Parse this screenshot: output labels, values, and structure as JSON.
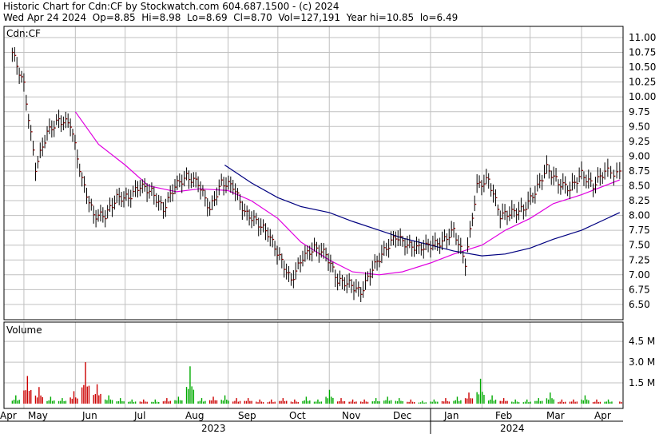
{
  "header": {
    "line1": "Historic Chart for Cdn:CF by Stockwatch.com 604.687.1500 - (c) 2024",
    "line2": "Wed Apr 24 2024  Op=8.85  Hi=8.98  Lo=8.69  Cl=8.70  Vol=127,191  Year hi=10.85  lo=6.49"
  },
  "colors": {
    "bar": "#8b0000",
    "ma_short": "#e000e0",
    "ma_long": "#000080",
    "vol_up": "#00aa00",
    "vol_down": "#cc0000",
    "grid": "#c0c0c0"
  },
  "chart_data": {
    "type": "line",
    "title": "Historic Chart for Cdn:CF",
    "symbol_label": "Cdn:CF",
    "price_axis": {
      "ticks": [
        "11.00",
        "10.75",
        "10.50",
        "10.25",
        "10.00",
        "9.75",
        "9.50",
        "9.25",
        "9.00",
        "8.75",
        "8.50",
        "8.25",
        "8.00",
        "7.75",
        "7.50",
        "7.25",
        "7.00",
        "6.75",
        "6.50"
      ],
      "ylim": [
        6.25,
        11.1
      ]
    },
    "volume_axis": {
      "label": "Volume",
      "ticks": [
        "4.5 M",
        "3.0 M",
        "1.5 M"
      ]
    },
    "months": [
      "Apr",
      "May",
      "Jun",
      "Jul",
      "Aug",
      "Sep",
      "Oct",
      "Nov",
      "Dec",
      "Jan",
      "Feb",
      "Mar",
      "Apr"
    ],
    "years": [
      "2023",
      "2024"
    ],
    "price_close_weekly": [
      {
        "t": "2023-04-24",
        "v": 10.75
      },
      {
        "t": "2023-05-01",
        "v": 10.2
      },
      {
        "t": "2023-05-08",
        "v": 8.8
      },
      {
        "t": "2023-05-15",
        "v": 9.4
      },
      {
        "t": "2023-05-22",
        "v": 9.6
      },
      {
        "t": "2023-05-29",
        "v": 9.55
      },
      {
        "t": "2023-06-05",
        "v": 8.6
      },
      {
        "t": "2023-06-12",
        "v": 8.0
      },
      {
        "t": "2023-06-19",
        "v": 8.0
      },
      {
        "t": "2023-06-26",
        "v": 8.3
      },
      {
        "t": "2023-07-03",
        "v": 8.3
      },
      {
        "t": "2023-07-10",
        "v": 8.5
      },
      {
        "t": "2023-07-17",
        "v": 8.4
      },
      {
        "t": "2023-07-24",
        "v": 8.1
      },
      {
        "t": "2023-07-31",
        "v": 8.5
      },
      {
        "t": "2023-08-07",
        "v": 8.65
      },
      {
        "t": "2023-08-14",
        "v": 8.55
      },
      {
        "t": "2023-08-21",
        "v": 8.1
      },
      {
        "t": "2023-08-28",
        "v": 8.55
      },
      {
        "t": "2023-09-04",
        "v": 8.5
      },
      {
        "t": "2023-09-11",
        "v": 8.05
      },
      {
        "t": "2023-09-18",
        "v": 7.9
      },
      {
        "t": "2023-09-25",
        "v": 7.7
      },
      {
        "t": "2023-10-02",
        "v": 7.3
      },
      {
        "t": "2023-10-09",
        "v": 6.9
      },
      {
        "t": "2023-10-16",
        "v": 7.3
      },
      {
        "t": "2023-10-23",
        "v": 7.45
      },
      {
        "t": "2023-10-30",
        "v": 7.35
      },
      {
        "t": "2023-11-06",
        "v": 6.9
      },
      {
        "t": "2023-11-13",
        "v": 6.85
      },
      {
        "t": "2023-11-20",
        "v": 6.7
      },
      {
        "t": "2023-11-27",
        "v": 7.1
      },
      {
        "t": "2023-12-04",
        "v": 7.4
      },
      {
        "t": "2023-12-11",
        "v": 7.65
      },
      {
        "t": "2023-12-18",
        "v": 7.5
      },
      {
        "t": "2023-12-25",
        "v": 7.45
      },
      {
        "t": "2024-01-01",
        "v": 7.5
      },
      {
        "t": "2024-01-08",
        "v": 7.55
      },
      {
        "t": "2024-01-15",
        "v": 7.75
      },
      {
        "t": "2024-01-22",
        "v": 7.2
      },
      {
        "t": "2024-01-29",
        "v": 8.5
      },
      {
        "t": "2024-02-05",
        "v": 8.6
      },
      {
        "t": "2024-02-12",
        "v": 8.0
      },
      {
        "t": "2024-02-19",
        "v": 8.05
      },
      {
        "t": "2024-02-26",
        "v": 8.1
      },
      {
        "t": "2024-03-04",
        "v": 8.4
      },
      {
        "t": "2024-03-11",
        "v": 8.8
      },
      {
        "t": "2024-03-18",
        "v": 8.55
      },
      {
        "t": "2024-03-25",
        "v": 8.45
      },
      {
        "t": "2024-04-01",
        "v": 8.7
      },
      {
        "t": "2024-04-08",
        "v": 8.5
      },
      {
        "t": "2024-04-15",
        "v": 8.75
      },
      {
        "t": "2024-04-24",
        "v": 8.7
      }
    ],
    "ma_short_weekly": [
      {
        "t": "2023-06-01",
        "v": 9.75
      },
      {
        "t": "2023-06-15",
        "v": 9.2
      },
      {
        "t": "2023-07-01",
        "v": 8.85
      },
      {
        "t": "2023-07-15",
        "v": 8.5
      },
      {
        "t": "2023-08-01",
        "v": 8.4
      },
      {
        "t": "2023-08-15",
        "v": 8.45
      },
      {
        "t": "2023-09-01",
        "v": 8.42
      },
      {
        "t": "2023-09-15",
        "v": 8.25
      },
      {
        "t": "2023-10-01",
        "v": 7.95
      },
      {
        "t": "2023-10-15",
        "v": 7.55
      },
      {
        "t": "2023-11-01",
        "v": 7.25
      },
      {
        "t": "2023-11-15",
        "v": 7.05
      },
      {
        "t": "2023-12-01",
        "v": 7.0
      },
      {
        "t": "2023-12-15",
        "v": 7.05
      },
      {
        "t": "2024-01-01",
        "v": 7.2
      },
      {
        "t": "2024-01-15",
        "v": 7.35
      },
      {
        "t": "2024-02-01",
        "v": 7.5
      },
      {
        "t": "2024-02-15",
        "v": 7.75
      },
      {
        "t": "2024-03-01",
        "v": 7.95
      },
      {
        "t": "2024-03-15",
        "v": 8.2
      },
      {
        "t": "2024-04-01",
        "v": 8.35
      },
      {
        "t": "2024-04-24",
        "v": 8.6
      }
    ],
    "ma_long_weekly": [
      {
        "t": "2023-08-30",
        "v": 8.85
      },
      {
        "t": "2023-09-15",
        "v": 8.55
      },
      {
        "t": "2023-10-01",
        "v": 8.3
      },
      {
        "t": "2023-10-15",
        "v": 8.15
      },
      {
        "t": "2023-11-01",
        "v": 8.05
      },
      {
        "t": "2023-11-15",
        "v": 7.9
      },
      {
        "t": "2023-12-01",
        "v": 7.75
      },
      {
        "t": "2023-12-15",
        "v": 7.62
      },
      {
        "t": "2024-01-01",
        "v": 7.5
      },
      {
        "t": "2024-01-15",
        "v": 7.4
      },
      {
        "t": "2024-02-01",
        "v": 7.32
      },
      {
        "t": "2024-02-15",
        "v": 7.35
      },
      {
        "t": "2024-03-01",
        "v": 7.45
      },
      {
        "t": "2024-03-15",
        "v": 7.6
      },
      {
        "t": "2024-04-01",
        "v": 7.75
      },
      {
        "t": "2024-04-24",
        "v": 8.05
      }
    ],
    "volume_weekly_millions": [
      {
        "t": "2023-04-24",
        "v": 0.6,
        "up": true
      },
      {
        "t": "2023-05-01",
        "v": 2.0,
        "up": false
      },
      {
        "t": "2023-05-08",
        "v": 1.2,
        "up": false
      },
      {
        "t": "2023-05-15",
        "v": 0.5,
        "up": true
      },
      {
        "t": "2023-05-22",
        "v": 0.4,
        "up": true
      },
      {
        "t": "2023-05-29",
        "v": 0.9,
        "up": false
      },
      {
        "t": "2023-06-05",
        "v": 3.0,
        "up": false
      },
      {
        "t": "2023-06-12",
        "v": 1.4,
        "up": false
      },
      {
        "t": "2023-06-19",
        "v": 0.6,
        "up": true
      },
      {
        "t": "2023-06-26",
        "v": 0.4,
        "up": true
      },
      {
        "t": "2023-07-03",
        "v": 0.3,
        "up": true
      },
      {
        "t": "2023-07-10",
        "v": 0.3,
        "up": false
      },
      {
        "t": "2023-07-17",
        "v": 0.3,
        "up": true
      },
      {
        "t": "2023-07-24",
        "v": 0.4,
        "up": false
      },
      {
        "t": "2023-07-31",
        "v": 0.5,
        "up": true
      },
      {
        "t": "2023-08-07",
        "v": 2.7,
        "up": true
      },
      {
        "t": "2023-08-14",
        "v": 0.4,
        "up": true
      },
      {
        "t": "2023-08-21",
        "v": 0.5,
        "up": false
      },
      {
        "t": "2023-08-28",
        "v": 0.6,
        "up": true
      },
      {
        "t": "2023-09-04",
        "v": 0.4,
        "up": false
      },
      {
        "t": "2023-09-11",
        "v": 0.4,
        "up": false
      },
      {
        "t": "2023-09-18",
        "v": 0.3,
        "up": false
      },
      {
        "t": "2023-09-25",
        "v": 0.3,
        "up": false
      },
      {
        "t": "2023-10-02",
        "v": 0.4,
        "up": false
      },
      {
        "t": "2023-10-09",
        "v": 0.3,
        "up": false
      },
      {
        "t": "2023-10-16",
        "v": 0.5,
        "up": true
      },
      {
        "t": "2023-10-23",
        "v": 0.3,
        "up": true
      },
      {
        "t": "2023-10-30",
        "v": 1.0,
        "up": true
      },
      {
        "t": "2023-11-06",
        "v": 0.4,
        "up": false
      },
      {
        "t": "2023-11-13",
        "v": 0.3,
        "up": false
      },
      {
        "t": "2023-11-20",
        "v": 0.3,
        "up": false
      },
      {
        "t": "2023-11-27",
        "v": 0.4,
        "up": true
      },
      {
        "t": "2023-12-04",
        "v": 0.5,
        "up": true
      },
      {
        "t": "2023-12-11",
        "v": 0.4,
        "up": true
      },
      {
        "t": "2023-12-18",
        "v": 0.3,
        "up": false
      },
      {
        "t": "2023-12-25",
        "v": 0.2,
        "up": true
      },
      {
        "t": "2024-01-01",
        "v": 0.3,
        "up": true
      },
      {
        "t": "2024-01-08",
        "v": 0.4,
        "up": false
      },
      {
        "t": "2024-01-15",
        "v": 0.5,
        "up": true
      },
      {
        "t": "2024-01-22",
        "v": 0.8,
        "up": false
      },
      {
        "t": "2024-01-29",
        "v": 1.8,
        "up": true
      },
      {
        "t": "2024-02-05",
        "v": 0.6,
        "up": true
      },
      {
        "t": "2024-02-12",
        "v": 0.4,
        "up": false
      },
      {
        "t": "2024-02-19",
        "v": 0.3,
        "up": true
      },
      {
        "t": "2024-02-26",
        "v": 0.3,
        "up": true
      },
      {
        "t": "2024-03-04",
        "v": 0.4,
        "up": true
      },
      {
        "t": "2024-03-11",
        "v": 0.8,
        "up": true
      },
      {
        "t": "2024-03-18",
        "v": 0.3,
        "up": false
      },
      {
        "t": "2024-03-25",
        "v": 0.3,
        "up": false
      },
      {
        "t": "2024-04-01",
        "v": 0.6,
        "up": true
      },
      {
        "t": "2024-04-08",
        "v": 0.3,
        "up": false
      },
      {
        "t": "2024-04-15",
        "v": 0.3,
        "up": true
      },
      {
        "t": "2024-04-24",
        "v": 0.3,
        "up": false
      }
    ]
  }
}
